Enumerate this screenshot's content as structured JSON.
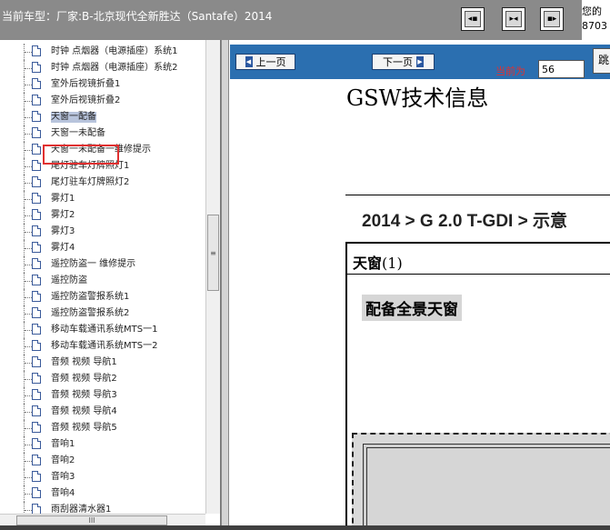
{
  "header": {
    "title": "当前车型：厂家:B-北京现代全新胜达（Santafe）2014",
    "nav_buttons": [
      {
        "name": "collapse-left-icon",
        "glyph": "◀▪"
      },
      {
        "name": "split-view-icon",
        "glyph": "▶◀"
      },
      {
        "name": "expand-right-icon",
        "glyph": "▪▶"
      }
    ],
    "corner_line1": "您的",
    "corner_line2": "8703"
  },
  "tree": {
    "items": [
      {
        "label": "时钟 点烟器（电源插座）系统1"
      },
      {
        "label": "时钟 点烟器（电源插座）系统2"
      },
      {
        "label": "室外后视镜折叠1"
      },
      {
        "label": "室外后视镜折叠2"
      },
      {
        "label": "天窗一配备",
        "selected": true
      },
      {
        "label": "天窗一未配备"
      },
      {
        "label": "天窗一未配备一维修提示"
      },
      {
        "label": "尾灯驻车灯牌照灯1"
      },
      {
        "label": "尾灯驻车灯牌照灯2"
      },
      {
        "label": "雾灯1"
      },
      {
        "label": "雾灯2"
      },
      {
        "label": "雾灯3"
      },
      {
        "label": "雾灯4"
      },
      {
        "label": "遥控防盗一 维修提示"
      },
      {
        "label": "遥控防盗"
      },
      {
        "label": "遥控防盗警报系统1"
      },
      {
        "label": "遥控防盗警报系统2"
      },
      {
        "label": "移动车载通讯系统MTS一1"
      },
      {
        "label": "移动车载通讯系统MTS一2"
      },
      {
        "label": "音频 视频 导航1"
      },
      {
        "label": "音频 视频 导航2"
      },
      {
        "label": "音频 视频 导航3"
      },
      {
        "label": "音频 视频 导航4"
      },
      {
        "label": "音频 视频 导航5"
      },
      {
        "label": "音响1"
      },
      {
        "label": "音响2"
      },
      {
        "label": "音响3"
      },
      {
        "label": "音响4"
      },
      {
        "label": "雨刮器清水器1"
      }
    ]
  },
  "toolbar": {
    "prev_label": "上一页",
    "next_label": "下一页",
    "current_label": "当前为",
    "page_value": "56",
    "jump_label": "跳"
  },
  "document": {
    "title": "GSW技术信息",
    "breadcrumb": "2014 > G 2.0 T-GDI > 示意",
    "section_title": "天窗",
    "section_suffix": "(1)",
    "subheading": "配备全景天窗"
  },
  "colors": {
    "topbar": "#8a8a8a",
    "toolbar": "#2b6fb0",
    "highlight_box": "#e03030",
    "current_label": "#e03030"
  }
}
